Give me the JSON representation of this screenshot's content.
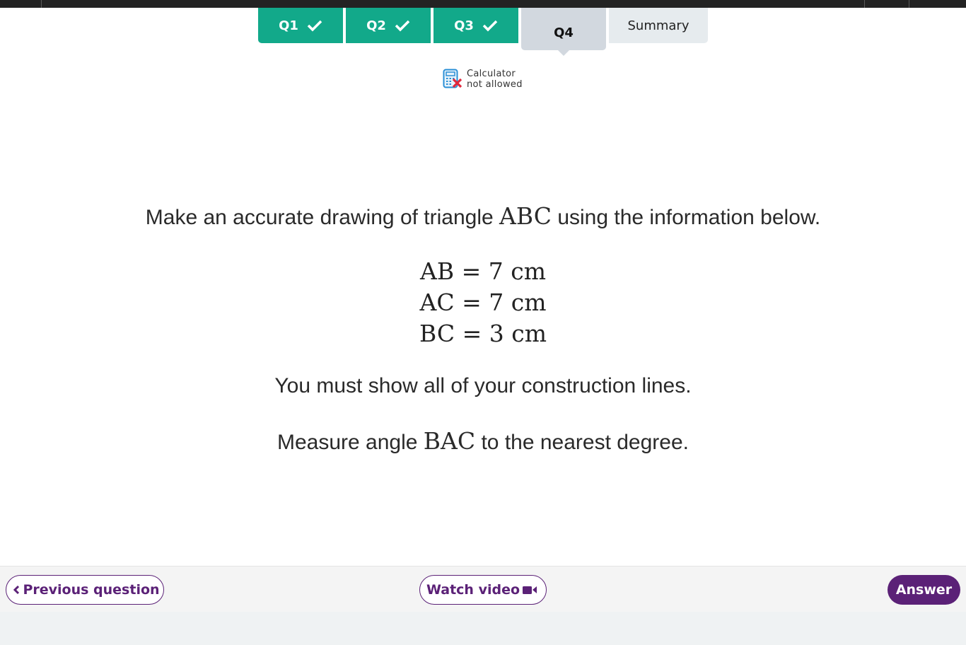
{
  "tabs": [
    {
      "label": "Q1",
      "state": "complete",
      "icon": "check-icon"
    },
    {
      "label": "Q2",
      "state": "complete",
      "icon": "check-icon"
    },
    {
      "label": "Q3",
      "state": "complete",
      "icon": "check-icon"
    },
    {
      "label": "Q4",
      "state": "current"
    },
    {
      "label": "Summary",
      "state": "inactive"
    }
  ],
  "calculator": {
    "icon": "calculator-not-allowed-icon",
    "line1": "Calculator",
    "line2": "not allowed"
  },
  "question": {
    "intro_before": "Make an accurate drawing of triangle ",
    "intro_math": "ABC",
    "intro_after": " using the information below.",
    "equations": [
      {
        "lhs": "AB",
        "value": "7",
        "unit": "cm"
      },
      {
        "lhs": "AC",
        "value": "7",
        "unit": "cm"
      },
      {
        "lhs": "BC",
        "value": "3",
        "unit": "cm"
      }
    ],
    "instruction": "You must show all of your construction lines.",
    "measure_before": "Measure angle ",
    "measure_math": "BAC",
    "measure_after": " to the nearest degree."
  },
  "footer": {
    "previous_label": "Previous question",
    "watch_label": "Watch video",
    "answer_label": "Answer"
  },
  "colors": {
    "complete_tab": "#12a98a",
    "current_tab": "#d2d8df",
    "summary_tab": "#e6ebee",
    "brand_purple": "#5b2177",
    "calc_x": "#e0283c",
    "calc_icon": "#2a8fd6"
  }
}
